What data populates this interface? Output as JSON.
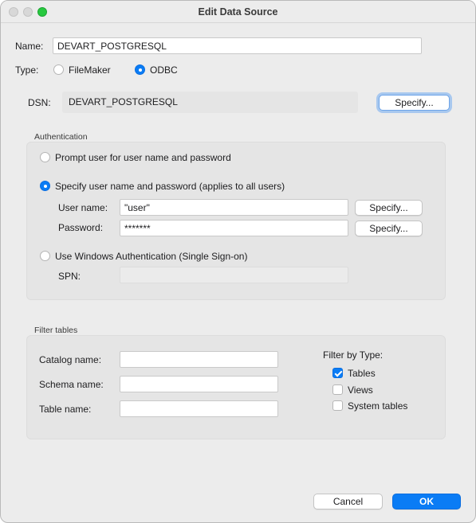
{
  "window": {
    "title": "Edit Data Source"
  },
  "name": {
    "label": "Name:",
    "value": "DEVART_POSTGRESQL"
  },
  "type": {
    "label": "Type:",
    "options": [
      {
        "label": "FileMaker",
        "selected": false
      },
      {
        "label": "ODBC",
        "selected": true
      }
    ]
  },
  "dsn": {
    "label": "DSN:",
    "value": "DEVART_POSTGRESQL",
    "specify_label": "Specify..."
  },
  "authentication": {
    "title": "Authentication",
    "prompt_option": "Prompt user for user name and password",
    "specify_option": "Specify user name and password (applies to all users)",
    "selected": "specify",
    "username_label": "User name:",
    "username_value": "\"user\"",
    "username_specify": "Specify...",
    "password_label": "Password:",
    "password_value": "*******",
    "password_specify": "Specify...",
    "windows_option": "Use Windows Authentication (Single Sign-on)",
    "spn_label": "SPN:",
    "spn_value": ""
  },
  "filter": {
    "title": "Filter tables",
    "catalog_label": "Catalog name:",
    "catalog_value": "",
    "schema_label": "Schema name:",
    "schema_value": "",
    "table_label": "Table name:",
    "table_value": "",
    "by_type_label": "Filter by Type:",
    "types": [
      {
        "label": "Tables",
        "checked": true
      },
      {
        "label": "Views",
        "checked": false
      },
      {
        "label": "System tables",
        "checked": false
      }
    ]
  },
  "footer": {
    "cancel_label": "Cancel",
    "ok_label": "OK"
  },
  "colors": {
    "accent": "#0a7cf5",
    "window_bg": "#ececec",
    "group_bg": "#e5e5e5"
  }
}
